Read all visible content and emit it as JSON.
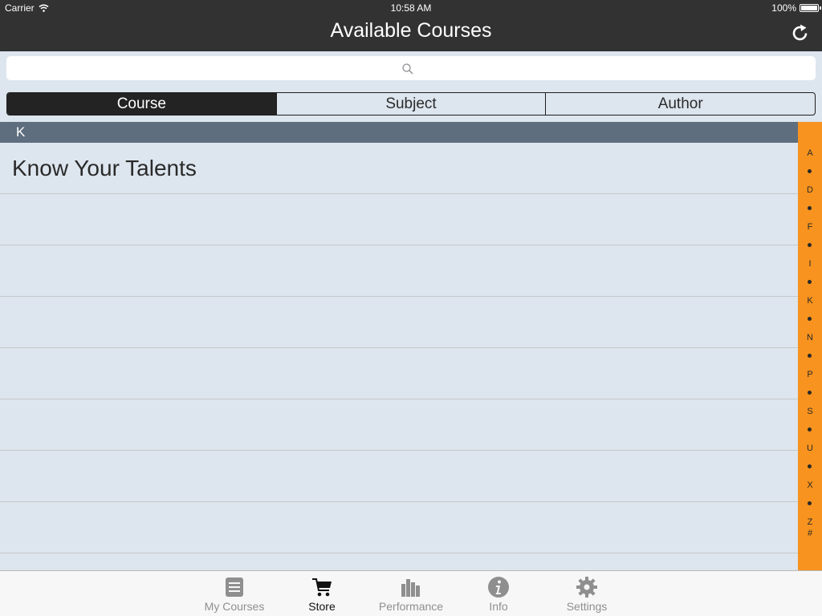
{
  "status_bar": {
    "carrier": "Carrier",
    "time": "10:58 AM",
    "battery": "100%"
  },
  "nav": {
    "title": "Available Courses",
    "refresh_icon": "refresh-icon"
  },
  "search": {
    "placeholder": "",
    "icon": "search-icon"
  },
  "segments": [
    {
      "label": "Course",
      "selected": true
    },
    {
      "label": "Subject",
      "selected": false
    },
    {
      "label": "Author",
      "selected": false
    }
  ],
  "list": {
    "section": "K",
    "rows": [
      {
        "title": "Know Your Talents"
      },
      {
        "title": ""
      },
      {
        "title": ""
      },
      {
        "title": ""
      },
      {
        "title": ""
      },
      {
        "title": ""
      },
      {
        "title": ""
      },
      {
        "title": ""
      }
    ]
  },
  "index": [
    "A",
    "•",
    "D",
    "•",
    "F",
    "•",
    "I",
    "•",
    "K",
    "•",
    "N",
    "•",
    "P",
    "•",
    "S",
    "•",
    "U",
    "•",
    "X",
    "•",
    "Z",
    "#"
  ],
  "tabs": [
    {
      "label": "My Courses",
      "icon": "book-icon",
      "active": false
    },
    {
      "label": "Store",
      "icon": "cart-icon",
      "active": true
    },
    {
      "label": "Performance",
      "icon": "bar-chart-icon",
      "active": false
    },
    {
      "label": "Info",
      "icon": "info-icon",
      "active": false
    },
    {
      "label": "Settings",
      "icon": "gear-icon",
      "active": false
    }
  ],
  "colors": {
    "accent": "#f7931e",
    "bar": "#323232",
    "section": "#5e6e7e",
    "background": "#dde5ee"
  }
}
